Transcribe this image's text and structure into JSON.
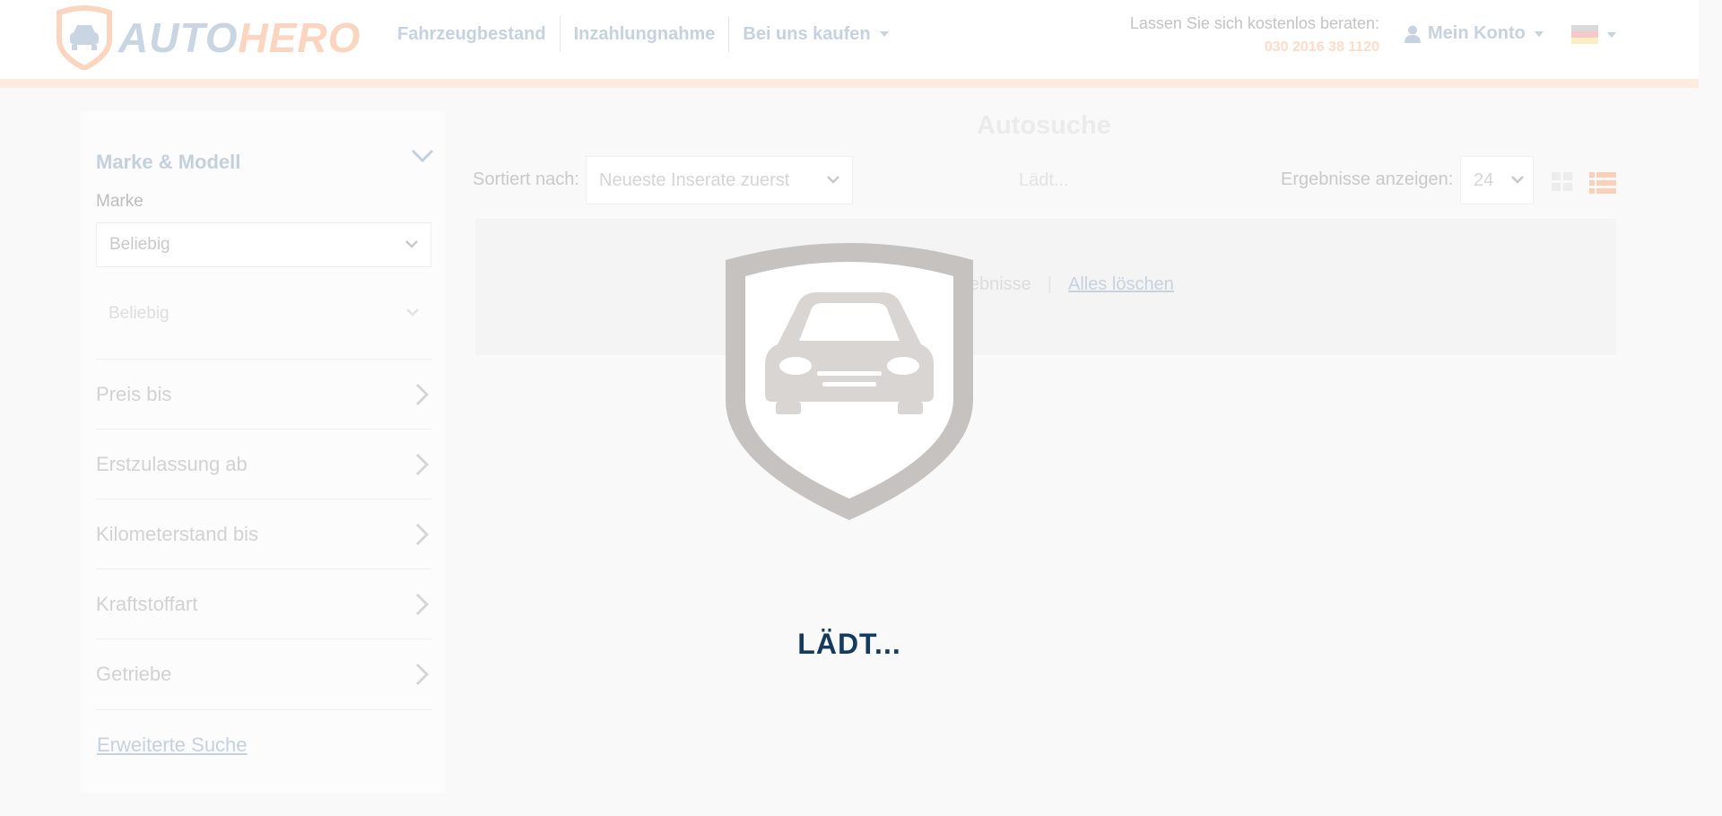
{
  "header": {
    "logo": {
      "part1": "AUTO",
      "part2": "HERO"
    },
    "nav": [
      {
        "label": "Fahrzeugbestand"
      },
      {
        "label": "Inzahlungnahme"
      },
      {
        "label": "Bei uns kaufen"
      }
    ],
    "advice_label": "Lassen Sie sich kostenlos beraten:",
    "phone": "030 2016 38 1120",
    "account_label": "Mein Konto",
    "language_icon": "germany-flag-icon"
  },
  "sidebar": {
    "section_title": "Marke & Modell",
    "brand_label": "Marke",
    "brand_value": "Beliebig",
    "model_value": "Beliebig",
    "filters": [
      {
        "label": "Preis bis"
      },
      {
        "label": "Erstzulassung ab"
      },
      {
        "label": "Kilometerstand bis"
      },
      {
        "label": "Kraftstoffart"
      },
      {
        "label": "Getriebe"
      }
    ],
    "advanced_search": "Erweiterte Suche"
  },
  "main": {
    "title": "Autosuche",
    "sort_label": "Sortiert nach:",
    "sort_value": "Neueste Inserate zuerst",
    "loading_small": "Lädt...",
    "results_label": "Ergebnisse anzeigen:",
    "results_value": "24",
    "no_results": "Keine Ergebnisse",
    "clear_all": "Alles löschen"
  },
  "overlay": {
    "loading_text": "LÄDT..."
  },
  "colors": {
    "brand_blue": "#143b5e",
    "brand_orange": "#f47b20"
  }
}
